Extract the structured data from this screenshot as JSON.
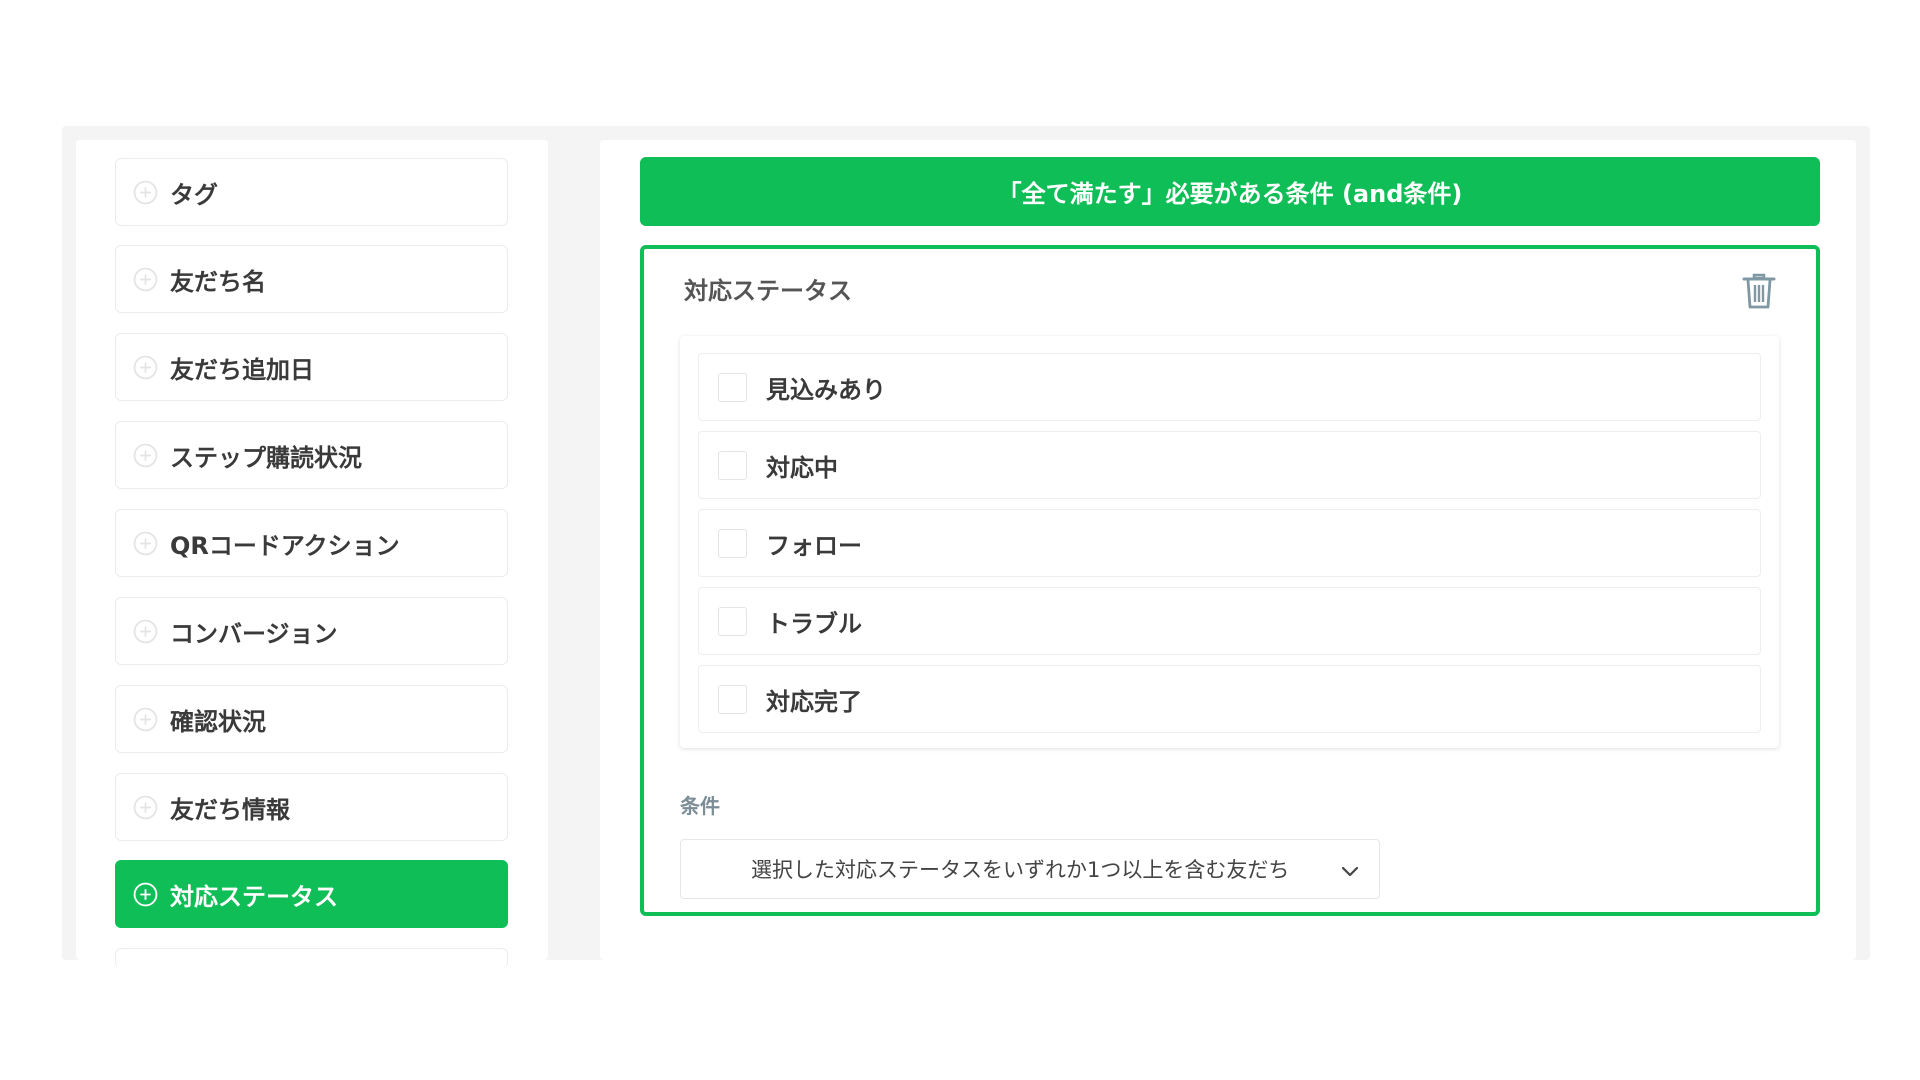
{
  "sidebar": {
    "items": [
      {
        "label": "タグ",
        "active": false
      },
      {
        "label": "友だち名",
        "active": false
      },
      {
        "label": "友だち追加日",
        "active": false
      },
      {
        "label": "ステップ購読状況",
        "active": false
      },
      {
        "label": "QRコードアクション",
        "active": false
      },
      {
        "label": "コンバージョン",
        "active": false
      },
      {
        "label": "確認状況",
        "active": false
      },
      {
        "label": "友だち情報",
        "active": false
      },
      {
        "label": "対応ステータス",
        "active": true
      }
    ]
  },
  "header": {
    "title": "「全て満たす」必要がある条件 (and条件)"
  },
  "condition": {
    "title": "対応ステータス",
    "options": [
      {
        "label": "見込みあり",
        "checked": false
      },
      {
        "label": "対応中",
        "checked": false
      },
      {
        "label": "フォロー",
        "checked": false
      },
      {
        "label": "トラブル",
        "checked": false
      },
      {
        "label": "対応完了",
        "checked": false
      }
    ],
    "condition_label": "条件",
    "select_value": "選択した対応ステータスをいずれか1つ以上を含む友だち"
  },
  "colors": {
    "accent": "#0fbe56",
    "panel_bg": "#f4f4f4",
    "text": "#3a3a3a",
    "muted_label": "#7a8c96"
  },
  "icons": {
    "sidebar_item": "plus-circle-icon",
    "delete": "trash-icon",
    "select": "chevron-down-icon"
  }
}
